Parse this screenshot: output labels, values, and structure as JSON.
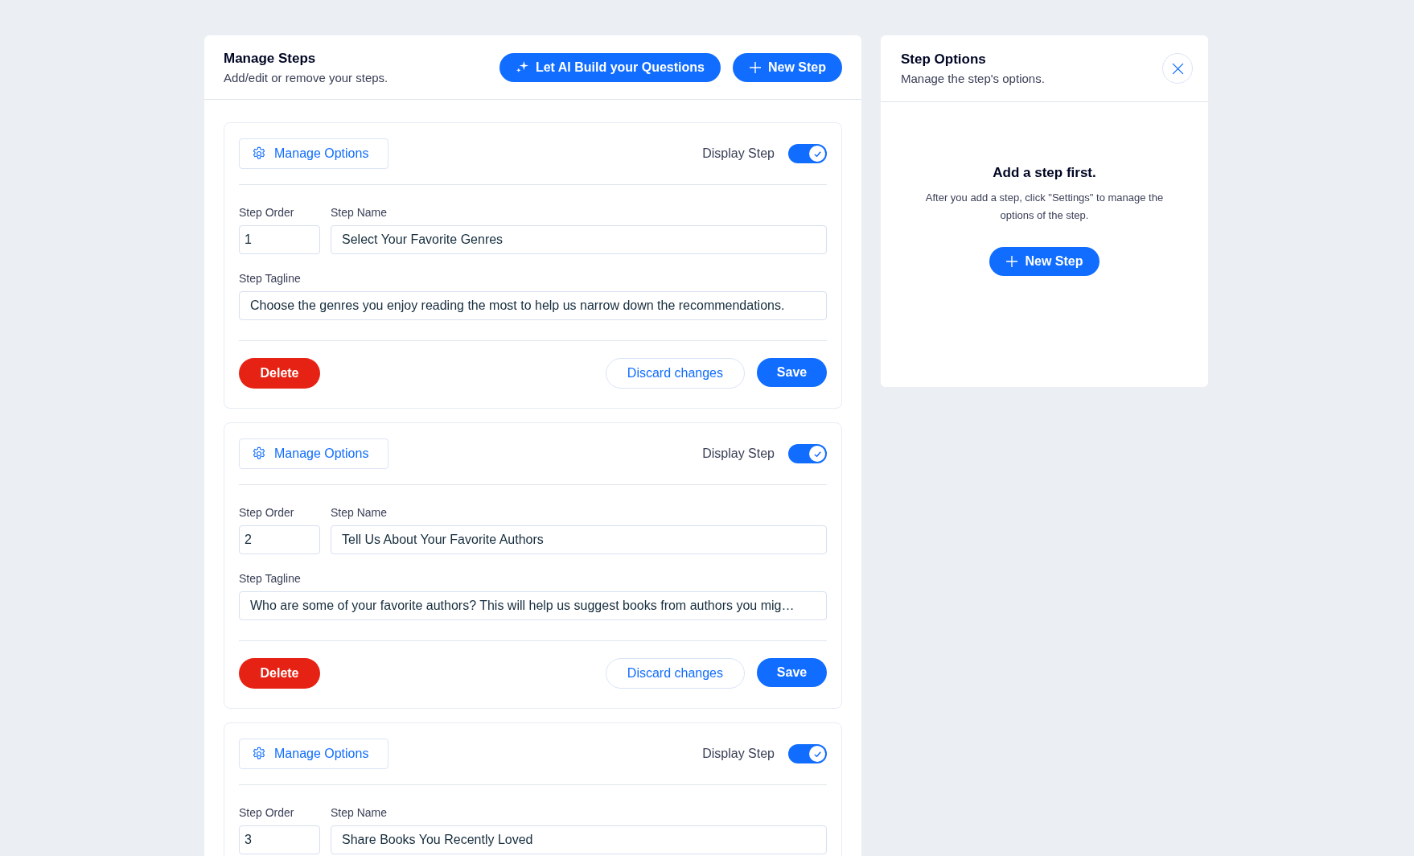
{
  "main": {
    "title": "Manage Steps",
    "subtitle": "Add/edit or remove your steps.",
    "ai_button": "Let AI Build your Questions",
    "new_step_button": "New Step"
  },
  "steps": [
    {
      "manage_options": "Manage Options",
      "display_label": "Display Step",
      "display_on": true,
      "order_label": "Step Order",
      "order": "1",
      "name_label": "Step Name",
      "name": "Select Your Favorite Genres",
      "tagline_label": "Step Tagline",
      "tagline": "Choose the genres you enjoy reading the most to help us narrow down the recommendations.",
      "delete": "Delete",
      "discard": "Discard changes",
      "save": "Save"
    },
    {
      "manage_options": "Manage Options",
      "display_label": "Display Step",
      "display_on": true,
      "order_label": "Step Order",
      "order": "2",
      "name_label": "Step Name",
      "name": "Tell Us About Your Favorite Authors",
      "tagline_label": "Step Tagline",
      "tagline": "Who are some of your favorite authors? This will help us suggest books from authors you mig…",
      "delete": "Delete",
      "discard": "Discard changes",
      "save": "Save"
    },
    {
      "manage_options": "Manage Options",
      "display_label": "Display Step",
      "display_on": true,
      "order_label": "Step Order",
      "order": "3",
      "name_label": "Step Name",
      "name": "Share Books You Recently Loved"
    }
  ],
  "options_panel": {
    "title": "Step Options",
    "subtitle": "Manage the step's options.",
    "empty_title": "Add a step first.",
    "empty_text": "After you add a step, click \"Settings\" to manage the options of the step.",
    "new_step_button": "New Step"
  }
}
